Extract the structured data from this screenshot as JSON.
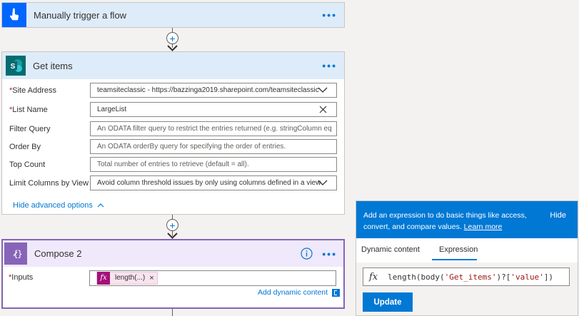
{
  "trigger": {
    "title": "Manually trigger a flow",
    "more": "•••"
  },
  "get_items": {
    "title": "Get items",
    "more": "•••",
    "fields": {
      "site_address": {
        "label": "Site Address",
        "value": "teamsiteclassic - https://bazzinga2019.sharepoint.com/teamsiteclassic"
      },
      "list_name": {
        "label": "List Name",
        "value": "LargeList"
      },
      "filter_query": {
        "label": "Filter Query",
        "placeholder": "An ODATA filter query to restrict the entries returned (e.g. stringColumn eq"
      },
      "order_by": {
        "label": "Order By",
        "placeholder": "An ODATA orderBy query for specifying the order of entries."
      },
      "top_count": {
        "label": "Top Count",
        "placeholder": "Total number of entries to retrieve (default = all)."
      },
      "limit_columns": {
        "label": "Limit Columns by View",
        "value": "Avoid column threshold issues by only using columns defined in a view"
      }
    },
    "hide_advanced": "Hide advanced options"
  },
  "compose": {
    "title": "Compose 2",
    "more": "•••",
    "inputs_label": "Inputs",
    "token_label": "length(...)",
    "token_remove": "×",
    "add_dynamic": "Add dynamic content"
  },
  "expression_panel": {
    "header_text": "Add an expression to do basic things like access, convert, and compare values.",
    "learn_more": "Learn more",
    "hide": "Hide",
    "tabs": [
      "Dynamic content",
      "Expression"
    ],
    "active_tab": "Expression",
    "fx_symbol": "fx",
    "expression_prefix": "length(body(",
    "expression_str1": "'Get_items'",
    "expression_mid": ")?[",
    "expression_str2": "'value'",
    "expression_suffix": "])",
    "update_label": "Update"
  },
  "colors": {
    "trigger_header": "#deecf9",
    "get_items_header": "#deecf9",
    "compose_header": "#efe9fb",
    "compose_accent": "#8764b8",
    "token_color": "#a4107a",
    "primary": "#0078d4"
  }
}
